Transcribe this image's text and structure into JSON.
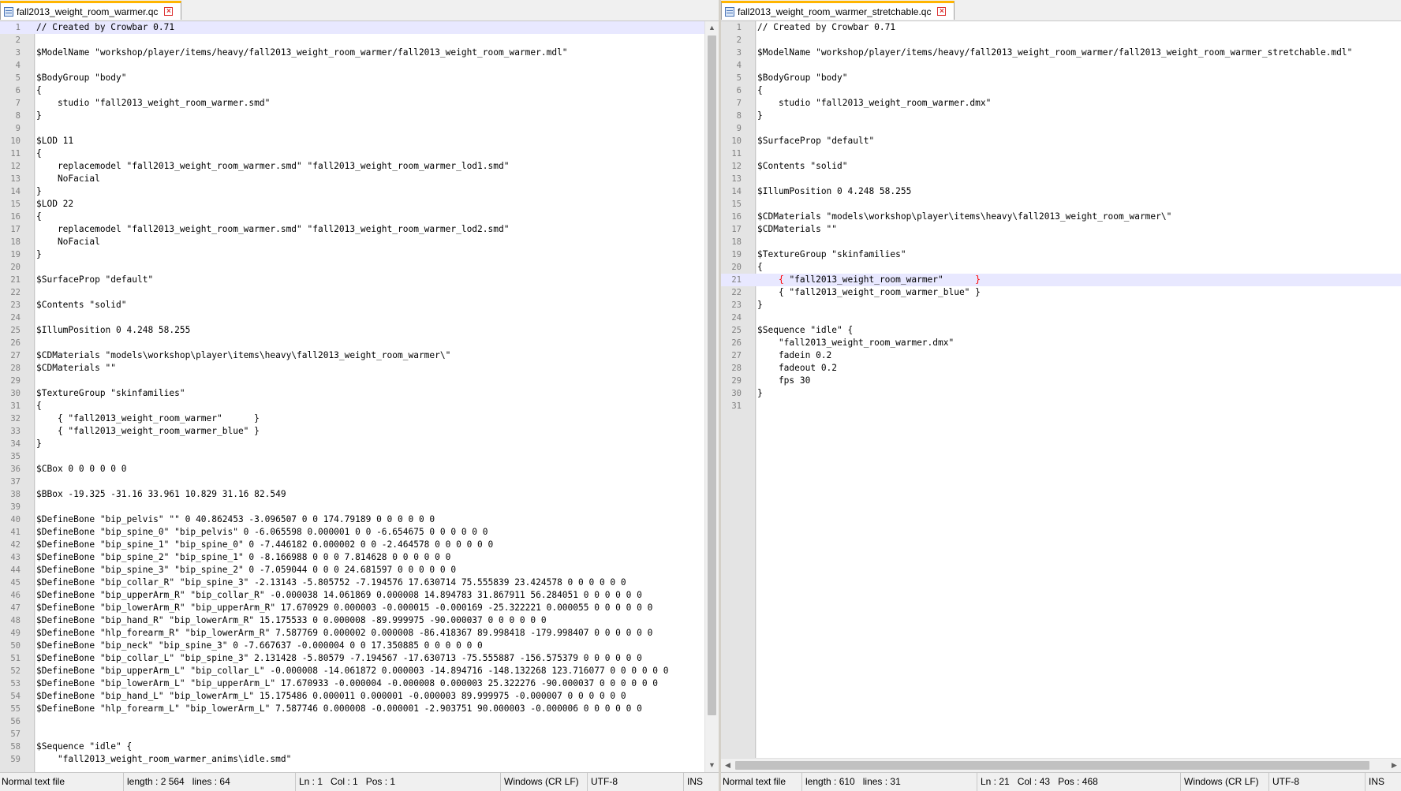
{
  "left": {
    "tab_label": "fall2013_weight_room_warmer.qc",
    "current_line": 1,
    "lines": [
      "// Created by Crowbar 0.71",
      "",
      "$ModelName \"workshop/player/items/heavy/fall2013_weight_room_warmer/fall2013_weight_room_warmer.mdl\"",
      "",
      "$BodyGroup \"body\"",
      "{",
      "    studio \"fall2013_weight_room_warmer.smd\"",
      "}",
      "",
      "$LOD 11",
      "{",
      "    replacemodel \"fall2013_weight_room_warmer.smd\" \"fall2013_weight_room_warmer_lod1.smd\"",
      "    NoFacial",
      "}",
      "$LOD 22",
      "{",
      "    replacemodel \"fall2013_weight_room_warmer.smd\" \"fall2013_weight_room_warmer_lod2.smd\"",
      "    NoFacial",
      "}",
      "",
      "$SurfaceProp \"default\"",
      "",
      "$Contents \"solid\"",
      "",
      "$IllumPosition 0 4.248 58.255",
      "",
      "$CDMaterials \"models\\workshop\\player\\items\\heavy\\fall2013_weight_room_warmer\\\"",
      "$CDMaterials \"\"",
      "",
      "$TextureGroup \"skinfamilies\"",
      "{",
      "    { \"fall2013_weight_room_warmer\"      }",
      "    { \"fall2013_weight_room_warmer_blue\" }",
      "}",
      "",
      "$CBox 0 0 0 0 0 0",
      "",
      "$BBox -19.325 -31.16 33.961 10.829 31.16 82.549",
      "",
      "$DefineBone \"bip_pelvis\" \"\" 0 40.862453 -3.096507 0 0 174.79189 0 0 0 0 0 0",
      "$DefineBone \"bip_spine_0\" \"bip_pelvis\" 0 -6.065598 0.000001 0 0 -6.654675 0 0 0 0 0 0",
      "$DefineBone \"bip_spine_1\" \"bip_spine_0\" 0 -7.446182 0.000002 0 0 -2.464578 0 0 0 0 0 0",
      "$DefineBone \"bip_spine_2\" \"bip_spine_1\" 0 -8.166988 0 0 0 7.814628 0 0 0 0 0 0",
      "$DefineBone \"bip_spine_3\" \"bip_spine_2\" 0 -7.059044 0 0 0 24.681597 0 0 0 0 0 0",
      "$DefineBone \"bip_collar_R\" \"bip_spine_3\" -2.13143 -5.805752 -7.194576 17.630714 75.555839 23.424578 0 0 0 0 0 0",
      "$DefineBone \"bip_upperArm_R\" \"bip_collar_R\" -0.000038 14.061869 0.000008 14.894783 31.867911 56.284051 0 0 0 0 0 0",
      "$DefineBone \"bip_lowerArm_R\" \"bip_upperArm_R\" 17.670929 0.000003 -0.000015 -0.000169 -25.322221 0.000055 0 0 0 0 0 0",
      "$DefineBone \"bip_hand_R\" \"bip_lowerArm_R\" 15.175533 0 0.000008 -89.999975 -90.000037 0 0 0 0 0 0",
      "$DefineBone \"hlp_forearm_R\" \"bip_lowerArm_R\" 7.587769 0.000002 0.000008 -86.418367 89.998418 -179.998407 0 0 0 0 0 0",
      "$DefineBone \"bip_neck\" \"bip_spine_3\" 0 -7.667637 -0.000004 0 0 17.350885 0 0 0 0 0 0",
      "$DefineBone \"bip_collar_L\" \"bip_spine_3\" 2.131428 -5.80579 -7.194567 -17.630713 -75.555887 -156.575379 0 0 0 0 0 0",
      "$DefineBone \"bip_upperArm_L\" \"bip_collar_L\" -0.000008 -14.061872 0.000003 -14.894716 -148.132268 123.716077 0 0 0 0 0 0",
      "$DefineBone \"bip_lowerArm_L\" \"bip_upperArm_L\" 17.670933 -0.000004 -0.000008 0.000003 25.322276 -90.000037 0 0 0 0 0 0",
      "$DefineBone \"bip_hand_L\" \"bip_lowerArm_L\" 15.175486 0.000011 0.000001 -0.000003 89.999975 -0.000007 0 0 0 0 0 0",
      "$DefineBone \"hlp_forearm_L\" \"bip_lowerArm_L\" 7.587746 0.000008 -0.000001 -2.903751 90.000003 -0.000006 0 0 0 0 0 0",
      "",
      "",
      "$Sequence \"idle\" {",
      "    \"fall2013_weight_room_warmer_anims\\idle.smd\""
    ],
    "status": {
      "type": "Normal text file",
      "length": "length : 2 564",
      "lines": "lines : 64",
      "ln": "Ln : 1",
      "col": "Col : 1",
      "pos": "Pos : 1",
      "eol": "Windows (CR LF)",
      "encoding": "UTF-8",
      "mode": "INS"
    }
  },
  "right": {
    "tab_label": "fall2013_weight_room_warmer_stretchable.qc",
    "current_line": 21,
    "lines": [
      "// Created by Crowbar 0.71",
      "",
      "$ModelName \"workshop/player/items/heavy/fall2013_weight_room_warmer/fall2013_weight_room_warmer_stretchable.mdl\"",
      "",
      "$BodyGroup \"body\"",
      "{",
      "    studio \"fall2013_weight_room_warmer.dmx\"",
      "}",
      "",
      "$SurfaceProp \"default\"",
      "",
      "$Contents \"solid\"",
      "",
      "$IllumPosition 0 4.248 58.255",
      "",
      "$CDMaterials \"models\\workshop\\player\\items\\heavy\\fall2013_weight_room_warmer\\\"",
      "$CDMaterials \"\"",
      "",
      "$TextureGroup \"skinfamilies\"",
      "{",
      "    { \"fall2013_weight_room_warmer\"      }",
      "    { \"fall2013_weight_room_warmer_blue\" }",
      "}",
      "",
      "$Sequence \"idle\" {",
      "    \"fall2013_weight_room_warmer.dmx\"",
      "    fadein 0.2",
      "    fadeout 0.2",
      "    fps 30",
      "}",
      ""
    ],
    "status": {
      "type": "Normal text file",
      "length": "length : 610",
      "lines": "lines : 31",
      "ln": "Ln : 21",
      "col": "Col : 43",
      "pos": "Pos : 468",
      "eol": "Windows (CR LF)",
      "encoding": "UTF-8",
      "mode": "INS"
    }
  },
  "icons": {
    "file": "file-icon",
    "close": "close-icon",
    "scroll_up": "▲",
    "scroll_down": "▼",
    "scroll_left": "◀",
    "scroll_right": "▶"
  },
  "colors": {
    "active_tab_accent": "#ffb500",
    "current_line": "#e8e8ff",
    "brace_match": "#ff0000",
    "close_icon": "#dd3333"
  }
}
